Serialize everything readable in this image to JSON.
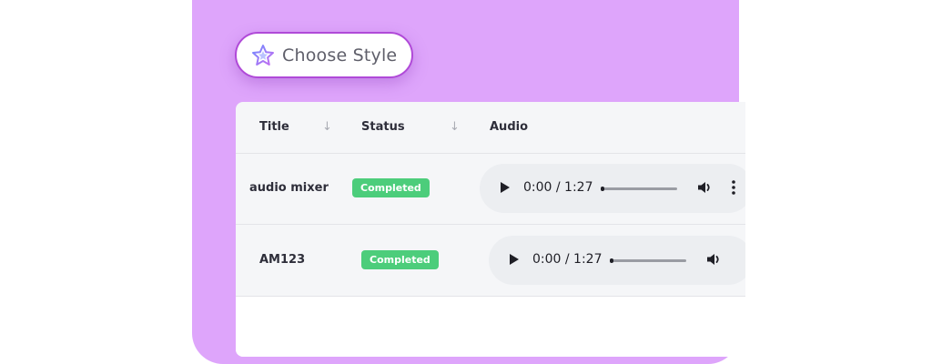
{
  "choose_style": {
    "label": "Choose Style",
    "icon": "star-icon"
  },
  "table": {
    "columns": [
      {
        "label": "Title",
        "sortable": true
      },
      {
        "label": "Status",
        "sortable": true
      },
      {
        "label": "Audio",
        "sortable": false
      }
    ],
    "sort_glyph": "↓",
    "rows": [
      {
        "title": "audio mixer",
        "status": "Completed",
        "time": "0:00 / 1:27"
      },
      {
        "title": "AM123",
        "status": "Completed",
        "time": "0:00 / 1:27"
      }
    ]
  },
  "colors": {
    "panel": "#dea5fb",
    "accent": "#b04ad8",
    "status_completed": "#4ccd7b"
  }
}
